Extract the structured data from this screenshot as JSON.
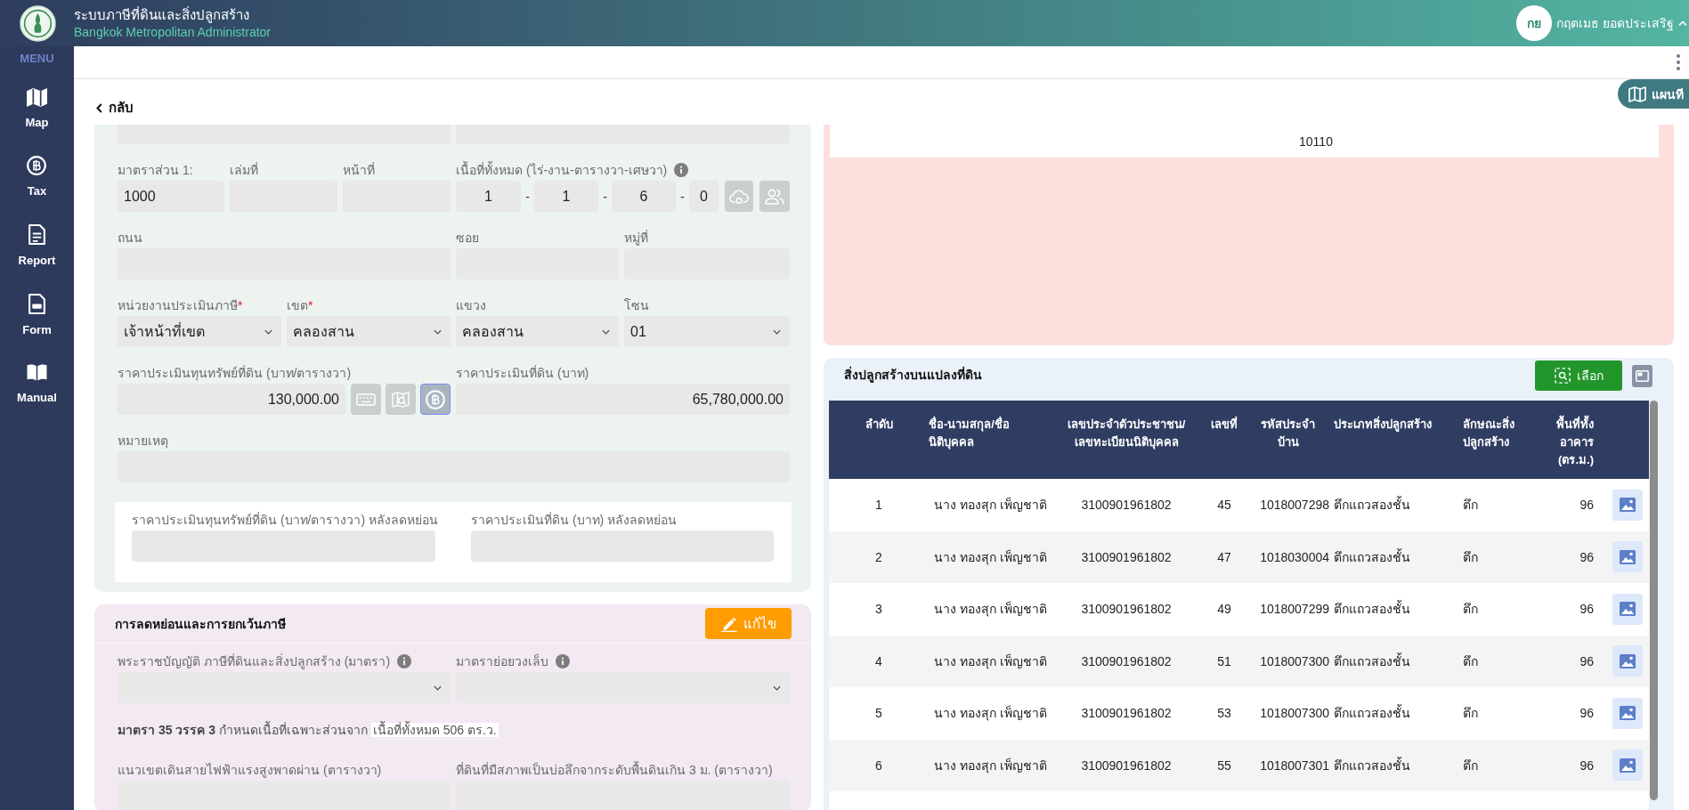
{
  "header": {
    "title": "ระบบภาษีที่ดินและสิ่งปลูกสร้าง",
    "subtitle": "Bangkok Metropolitan Administrator",
    "user": {
      "initials": "กย",
      "name": "กฤตเมธ ยอดประเสริฐ"
    }
  },
  "sidebar": {
    "heading": "MENU",
    "items": [
      {
        "label": "Map"
      },
      {
        "label": "Tax"
      },
      {
        "label": "Report"
      },
      {
        "label": "Form"
      },
      {
        "label": "Manual"
      }
    ]
  },
  "toolbar": {
    "back_link": "กลับ",
    "map_button": "แผนที"
  },
  "land_details": {
    "scale": {
      "label": "มาตราส่วน 1:",
      "value": "1000"
    },
    "book_no": {
      "label": "เล่มที่"
    },
    "page_no": {
      "label": "หน้าที่"
    },
    "total_area": {
      "label": "เนื้อที่ทั้งหมด (ไร่-งาน-ตารางวา-เศษวา)",
      "parts": [
        "1",
        "1",
        "6",
        "0"
      ],
      "separators": [
        "-",
        "-",
        "-"
      ]
    },
    "road": {
      "label": "ถนน"
    },
    "soi": {
      "label": "ซอย"
    },
    "moo": {
      "label": "หมู่ที่"
    },
    "assessment_unit": {
      "label": "หน่วยงานประเมินภาษี",
      "required_mark": "*",
      "value": "เจ้าหน้าที่เขต"
    },
    "district": {
      "label": "เขต",
      "required_mark": "*",
      "value": "คลองสาน"
    },
    "subdistrict": {
      "label": "แขวง",
      "value": "คลองสาน"
    },
    "zone": {
      "label": "โซน",
      "value": "01"
    },
    "price_per_wa": {
      "label": "ราคาประเมินทุนทรัพย์ที่ดิน (บาท/ตารางวา)",
      "value": "130,000.00",
      "tools": [
        {
          "selected": false
        },
        {
          "selected": false
        },
        {
          "selected": true
        }
      ]
    },
    "land_price": {
      "label": "ราคาประเมินที่ดิน (บาท)",
      "value": "65,780,000.00"
    },
    "remark": {
      "label": "หมายเหตุ"
    },
    "after_discount": [
      {
        "label": "ราคาประเมินทุนทรัพย์ที่ดิน (บาท/ตารางวา) หลังลดหย่อน"
      },
      {
        "label": "ราคาประเมินที่ดิน (บาท) หลังลดหย่อน"
      }
    ]
  },
  "exemptions": {
    "title": "การลดหย่อนและการยกเว้นภาษี",
    "edit_button": "แก้ไข",
    "act_section": {
      "label": "พระราชบัญญัติ ภาษีที่ดินและสิ่งปลูกสร้าง (มาตรา)"
    },
    "sub_section": {
      "label": "มาตราย่อยวงเล็บ"
    },
    "note": {
      "text": "**มาตรา 35 วรรค 3** กำหนดเนื้อที่เฉพาะส่วนจาก",
      "highlight": "เนื้อที่ทั้งหมด 506 ตร.ว."
    },
    "power_line_area": {
      "label": "แนวเขตเดินสายไฟฟ้าแรงสูงพาดผ่าน (ตารางวา)"
    },
    "pit_area": {
      "label": "ที่ดินที่มีสภาพเป็นบ่อลึกจากระดับพื้นดินเกิน 3 ม. (ตารางวา)"
    }
  },
  "upper_right_panel": {
    "cell": "10110"
  },
  "buildings": {
    "title": "สิ่งปลูกสร้างบนแปลงที่ดิน",
    "select_button": "เลือก",
    "columns": [
      "ลำดับ",
      "ชื่อ-นามสกุล/ชื่อ\nนิติบุคคล",
      "เลขประจำตัวประชาชน/\nเลขทะเบียนนิติบุคคล",
      "เลขที่",
      "รหัสประจำ\nบ้าน",
      "ประเภทสิ่งปลูกสร้าง",
      "ลักษณะสิ่ง\nปลูกสร้าง",
      "พื้นที่ทั้ง\nอาคาร\n(ตร.ม.)"
    ],
    "rows": [
      [
        "1",
        "นาง ทองสุก เพ็ญชาติ",
        "3100901961802",
        "45",
        "1018007298",
        "ตึกแถวสองชั้น",
        "ตึก",
        "96"
      ],
      [
        "2",
        "นาง ทองสุก เพ็ญชาติ",
        "3100901961802",
        "47",
        "1018030004",
        "ตึกแถวสองชั้น",
        "ตึก",
        "96"
      ],
      [
        "3",
        "นาง ทองสุก เพ็ญชาติ",
        "3100901961802",
        "49",
        "1018007299",
        "ตึกแถวสองชั้น",
        "ตึก",
        "96"
      ],
      [
        "4",
        "นาง ทองสุก เพ็ญชาติ",
        "3100901961802",
        "51",
        "1018007300",
        "ตึกแถวสองชั้น",
        "ตึก",
        "96"
      ],
      [
        "5",
        "นาง ทองสุก เพ็ญชาติ",
        "3100901961802",
        "53",
        "1018007300",
        "ตึกแถวสองชั้น",
        "ตึก",
        "96"
      ],
      [
        "6",
        "นาง ทองสุก เพ็ญชาติ",
        "3100901961802",
        "55",
        "1018007301",
        "ตึกแถวสองชั้น",
        "ตึก",
        "96"
      ]
    ]
  }
}
